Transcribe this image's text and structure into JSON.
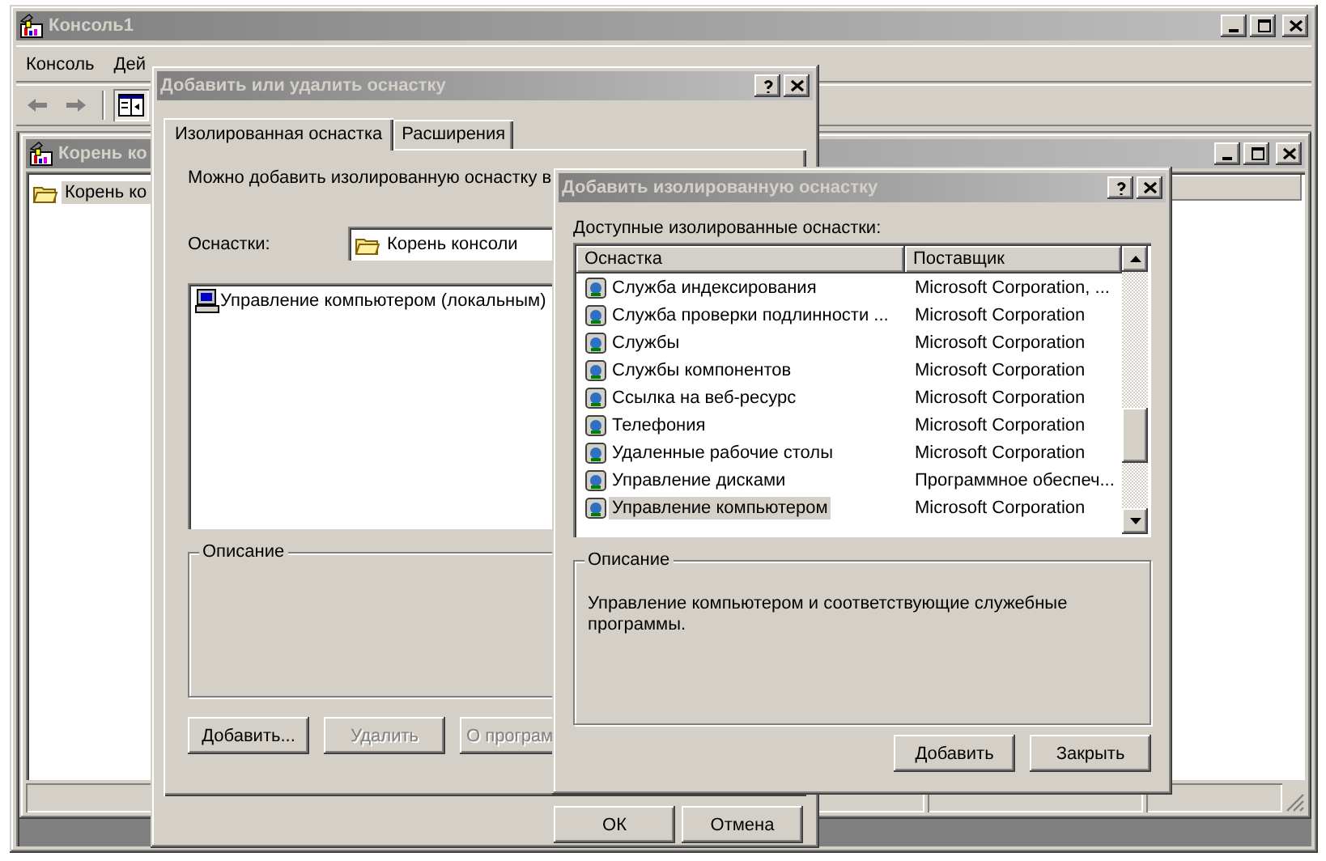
{
  "main_window": {
    "title": "Консоль1",
    "menu": [
      {
        "label": "Консоль"
      },
      {
        "label": "Дей"
      }
    ]
  },
  "child_window": {
    "title": "Корень ко",
    "tree": [
      {
        "label": "Корень ко",
        "selected": true
      }
    ]
  },
  "snapin_dialog": {
    "title": "Добавить или удалить оснастку",
    "tabs": [
      {
        "label": "Изолированная оснастка",
        "selected": true
      },
      {
        "label": "Расширения",
        "selected": false
      }
    ],
    "intro": "Можно добавить изолированную оснастку в",
    "snapins_label": "Оснастки:",
    "snapins_value": "Корень консоли",
    "items": [
      {
        "label": "Управление компьютером (локальным)"
      }
    ],
    "description_title": "Описание",
    "buttons": [
      {
        "label": "Добавить...",
        "disabled": false
      },
      {
        "label": "Удалить",
        "disabled": true
      },
      {
        "label": "О програм",
        "disabled": true
      }
    ],
    "footer_buttons": [
      "ОК",
      "Отмена"
    ]
  },
  "add_dialog": {
    "title": "Добавить изолированную оснастку",
    "list_label": "Доступные изолированные оснастки:",
    "columns": [
      "Оснастка",
      "Поставщик"
    ],
    "rows": [
      {
        "name": "Служба индексирования",
        "vendor": "Microsoft Corporation, ...",
        "selected": false
      },
      {
        "name": "Служба проверки подлинности ...",
        "vendor": "Microsoft Corporation",
        "selected": false
      },
      {
        "name": "Службы",
        "vendor": "Microsoft Corporation",
        "selected": false
      },
      {
        "name": "Службы компонентов",
        "vendor": "Microsoft Corporation",
        "selected": false
      },
      {
        "name": "Ссылка на веб-ресурс",
        "vendor": "Microsoft Corporation",
        "selected": false
      },
      {
        "name": "Телефония",
        "vendor": "Microsoft Corporation",
        "selected": false
      },
      {
        "name": "Удаленные рабочие столы",
        "vendor": "Microsoft Corporation",
        "selected": false
      },
      {
        "name": "Управление дисками",
        "vendor": "Программное обеспеч...",
        "selected": false
      },
      {
        "name": "Управление компьютером",
        "vendor": "Microsoft Corporation",
        "selected": true
      }
    ],
    "description_title": "Описание",
    "description": "Управление компьютером и соответствующие служебные программы.",
    "buttons": [
      "Добавить",
      "Закрыть"
    ]
  }
}
